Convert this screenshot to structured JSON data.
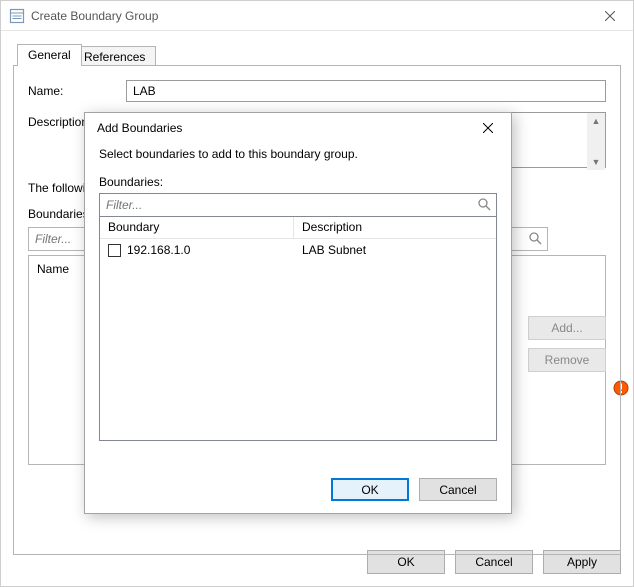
{
  "main": {
    "title": "Create Boundary Group",
    "tabs": {
      "general": "General",
      "references": "References"
    },
    "name_label": "Name:",
    "name_value": "LAB",
    "desc_label": "Description:",
    "desc_value": "",
    "members_text": "The following boundaries are members of this boundary group.",
    "boundaries_label": "Boundaries:",
    "filter_placeholder": "Filter...",
    "list_header_name": "Name",
    "side_add": "Add...",
    "side_remove": "Remove",
    "ok": "OK",
    "cancel": "Cancel",
    "apply": "Apply"
  },
  "modal": {
    "title": "Add Boundaries",
    "instruction": "Select boundaries to add to this boundary group.",
    "boundaries_label": "Boundaries:",
    "filter_placeholder": "Filter...",
    "col_boundary": "Boundary",
    "col_description": "Description",
    "rows": [
      {
        "boundary": "192.168.1.0",
        "description": "LAB Subnet",
        "checked": false
      }
    ],
    "ok": "OK",
    "cancel": "Cancel"
  }
}
